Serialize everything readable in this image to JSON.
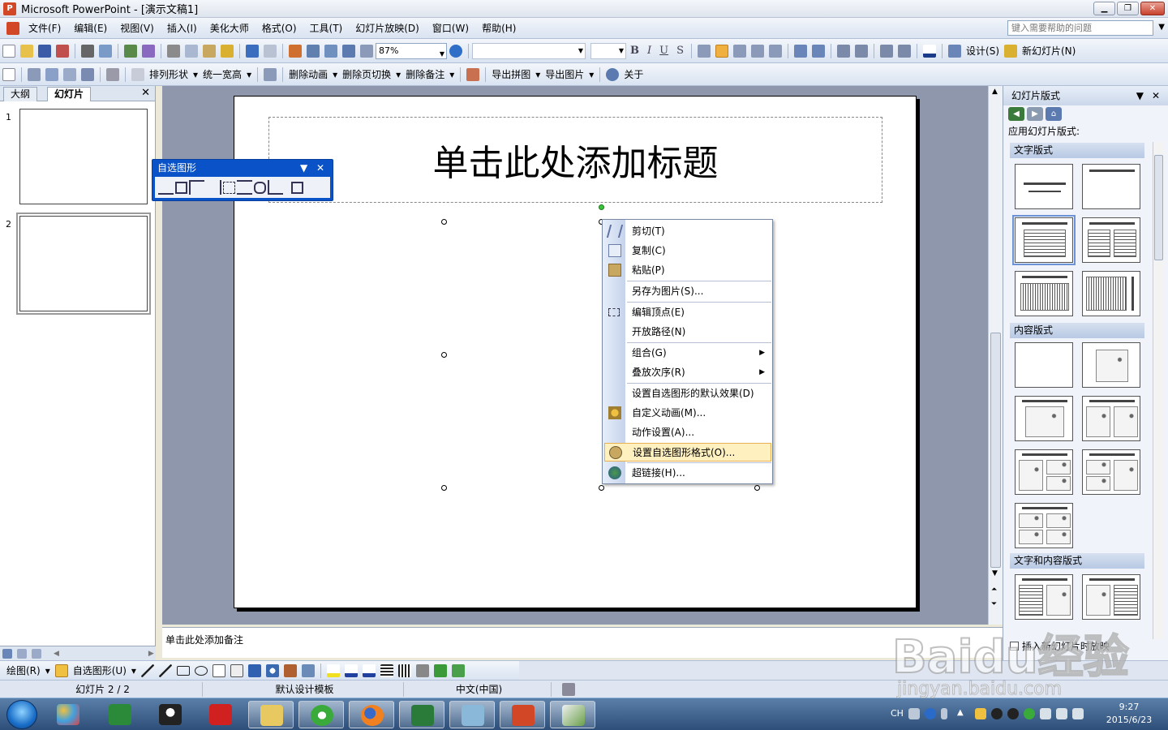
{
  "window": {
    "title": "Microsoft PowerPoint - [演示文稿1]"
  },
  "menu": {
    "items": [
      "文件(F)",
      "编辑(E)",
      "视图(V)",
      "插入(I)",
      "美化大师",
      "格式(O)",
      "工具(T)",
      "幻灯片放映(D)",
      "窗口(W)",
      "帮助(H)"
    ],
    "help_placeholder": "键入需要帮助的问题"
  },
  "toolbar": {
    "zoom": "87%",
    "design_label": "设计(S)",
    "new_slide_label": "新幻灯片(N)",
    "arrange_label": "排列形状",
    "uniform_label": "统一宽高",
    "delete_anim_label": "删除动画",
    "delete_trans_label": "删除页切换",
    "delete_notes_label": "删除备注",
    "export_combined_label": "导出拼图",
    "export_images_label": "导出图片",
    "about_label": "关于"
  },
  "left_pane": {
    "tabs": [
      "大纲",
      "幻灯片"
    ],
    "slides": [
      "1",
      "2"
    ]
  },
  "slide": {
    "title_placeholder": "单击此处添加标题"
  },
  "notes": {
    "placeholder": "单击此处添加备注"
  },
  "autoshape_toolbar": {
    "title": "自选图形"
  },
  "context_menu": {
    "items": [
      {
        "label": "剪切(T)",
        "icon": "scissors-icon"
      },
      {
        "label": "复制(C)",
        "icon": "copy-icon"
      },
      {
        "label": "粘贴(P)",
        "icon": "paste-icon"
      },
      {
        "label": "另存为图片(S)...",
        "icon": ""
      },
      {
        "label": "编辑顶点(E)",
        "icon": "edit-points-icon"
      },
      {
        "label": "开放路径(N)",
        "icon": ""
      },
      {
        "label": "组合(G)",
        "icon": ""
      },
      {
        "label": "叠放次序(R)",
        "icon": ""
      },
      {
        "label": "设置自选图形的默认效果(D)",
        "icon": ""
      },
      {
        "label": "自定义动画(M)...",
        "icon": "custom-animation-icon"
      },
      {
        "label": "动作设置(A)...",
        "icon": ""
      },
      {
        "label": "设置自选图形格式(O)...",
        "icon": "format-shape-icon"
      },
      {
        "label": "超链接(H)...",
        "icon": "hyperlink-icon"
      }
    ]
  },
  "task_pane": {
    "title": "幻灯片版式",
    "apply_label": "应用幻灯片版式:",
    "sections": [
      "文字版式",
      "内容版式",
      "文字和内容版式"
    ],
    "footer": "插入新幻灯片时放映"
  },
  "drawing_toolbar": {
    "draw_label": "绘图(R)",
    "autoshapes_label": "自选图形(U)"
  },
  "status": {
    "slide_pos": "幻灯片 2 / 2",
    "template": "默认设计模板",
    "language": "中文(中国)"
  },
  "clock": {
    "time": "9:27",
    "date": "2015/6/23"
  },
  "tray": {
    "lang": "CH"
  },
  "watermark": {
    "main": "Baidu经验",
    "sub": "jingyan.baidu.com"
  },
  "colors": {
    "accent_blue": "#0a52c8",
    "highlight": "#fff0c0",
    "canvas": "#8e97ac"
  }
}
